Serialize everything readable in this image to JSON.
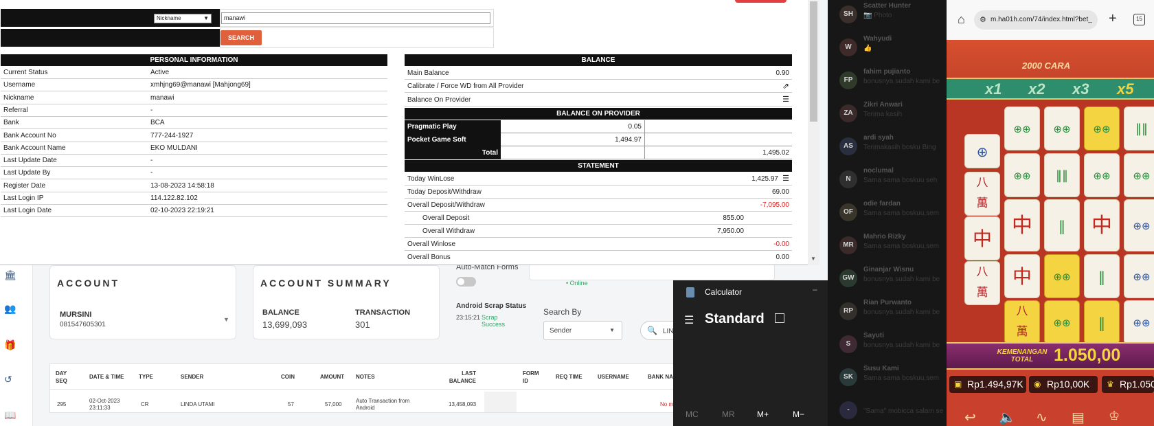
{
  "search": {
    "select_value": "Nickname",
    "input_value": "manawi",
    "button_label": "SEARCH"
  },
  "personal": {
    "title": "PERSONAL INFORMATION",
    "rows": [
      {
        "label": "Current Status",
        "value": "Active"
      },
      {
        "label": "Username",
        "value": "xmhjng69@manawi  [Mahjong69]"
      },
      {
        "label": "Nickname",
        "value": "manawi"
      },
      {
        "label": "Referral",
        "value": "-"
      },
      {
        "label": "Bank",
        "value": "BCA"
      },
      {
        "label": "Bank Account No",
        "value": "777-244-1927"
      },
      {
        "label": "Bank Account Name",
        "value": "EKO MULDANI"
      },
      {
        "label": "Last Update Date",
        "value": "-"
      },
      {
        "label": "Last Update By",
        "value": "-"
      },
      {
        "label": "Register Date",
        "value": "13-08-2023 14:58:18"
      },
      {
        "label": "Last Login IP",
        "value": "114.122.82.102"
      },
      {
        "label": "Last Login Date",
        "value": "02-10-2023 22:19:21"
      }
    ]
  },
  "balance": {
    "title": "BALANCE",
    "main_label": "Main Balance",
    "main_value": "0.90",
    "calibrate_label": "Calibrate / Force WD from All Provider",
    "provider_label": "Balance On Provider",
    "provider_title": "BALANCE ON PROVIDER",
    "providers": [
      {
        "name": "Pragmatic Play",
        "value": "0.05"
      },
      {
        "name": "Pocket Game Soft",
        "value": "1,494.97"
      }
    ],
    "total_label": "Total",
    "total_value": "1,495.02"
  },
  "statement": {
    "title": "STATEMENT",
    "today_winlose_label": "Today WinLose",
    "today_winlose_value": "1,425.97",
    "today_dw_label": "Today Deposit/Withdraw",
    "today_dw_value": "69.00",
    "overall_dw_label": "Overall Deposit/Withdraw",
    "overall_dw_value": "-7,095.00",
    "overall_deposit_label": "Overall Deposit",
    "overall_deposit_value": "855.00",
    "overall_withdraw_label": "Overall Withdraw",
    "overall_withdraw_value": "7,950.00",
    "overall_winlose_label": "Overall Winlose",
    "overall_winlose_value": "-0.00",
    "overall_bonus_label": "Overall Bonus",
    "overall_bonus_value": "0.00"
  },
  "account": {
    "title": "ACCOUNT",
    "name": "MURSINI",
    "phone": "081547605301"
  },
  "summary": {
    "title": "ACCOUNT SUMMARY",
    "balance_label": "BALANCE",
    "balance_value": "13,699,093",
    "transaction_label": "TRANSACTION",
    "transaction_value": "301"
  },
  "controls": {
    "auto_match": "Auto-Match Forms",
    "online": "• Online",
    "scrap_title": "Android Scrap Status",
    "scrap_time": "23:15:21",
    "scrap_status": "Scrap Success",
    "search_by_label": "Search By",
    "search_by_value": "Sender",
    "search_partial": "LIN"
  },
  "table": {
    "headers": [
      "DAY SEQ",
      "DATE & TIME",
      "TYPE",
      "SENDER",
      "COIN",
      "AMOUNT",
      "NOTES",
      "LAST BALANCE",
      "FORM ID",
      "REQ TIME",
      "USERNAME",
      "BANK NA"
    ],
    "row": {
      "seq": "295",
      "datetime": "02-Oct-2023 23:11:33",
      "type": "CR",
      "sender": "LINDA UTAMI",
      "coin": "57",
      "amount": "57,000",
      "notes": "Auto Transaction from Android",
      "last_balance": "13,458,093",
      "partial": "No m"
    }
  },
  "calculator": {
    "app_name": "Calculator",
    "mode": "Standard",
    "memory": [
      "MC",
      "MR",
      "M+",
      "M−"
    ]
  },
  "chat": {
    "items": [
      {
        "initials": "SH",
        "name": "Scatter Hunter",
        "msg": "📷 Photo"
      },
      {
        "initials": "W",
        "name": "Wahyudi",
        "msg": "👍"
      },
      {
        "initials": "FP",
        "name": "fahim pujianto",
        "msg": "bonusnya sudah kami be"
      },
      {
        "initials": "ZA",
        "name": "Zikri Anwari",
        "msg": "Terima kasih"
      },
      {
        "initials": "AS",
        "name": "ardi syah",
        "msg": "Terimakasih bosku Bing"
      },
      {
        "initials": "N",
        "name": "noclumal",
        "msg": "Sama sama boskuu seh"
      },
      {
        "initials": "OF",
        "name": "odie fardan",
        "msg": "Sama sama boskuu,sem"
      },
      {
        "initials": "MR",
        "name": "Mahrio Rizky",
        "msg": "Sama sama boskuu,sem"
      },
      {
        "initials": "GW",
        "name": "Ginanjar Wisnu",
        "msg": "bonusnya sudah kami be"
      },
      {
        "initials": "RP",
        "name": "Rian Purwanto",
        "msg": "bonusnya sudah kami be"
      },
      {
        "initials": "S",
        "name": "Sayuti",
        "msg": "bonusnya sudah kami be"
      },
      {
        "initials": "SK",
        "name": "Susu Kami",
        "msg": "Sama sama boskuu,sem"
      },
      {
        "initials": "-",
        "name": "",
        "msg": "\"Sama\" mobicca salam se"
      }
    ]
  },
  "phone": {
    "url": "m.ha01h.com/74/index.html?bet_",
    "tab_count": "15",
    "ways": "2000 CARA",
    "multipliers": [
      "x1",
      "x2",
      "x3",
      "x5"
    ],
    "win_label": "KEMENANGAN TOTAL",
    "win_value": "1.050,00",
    "balance": "Rp1.494,97K",
    "bet": "Rp10,00K",
    "win": "Rp1.050"
  }
}
